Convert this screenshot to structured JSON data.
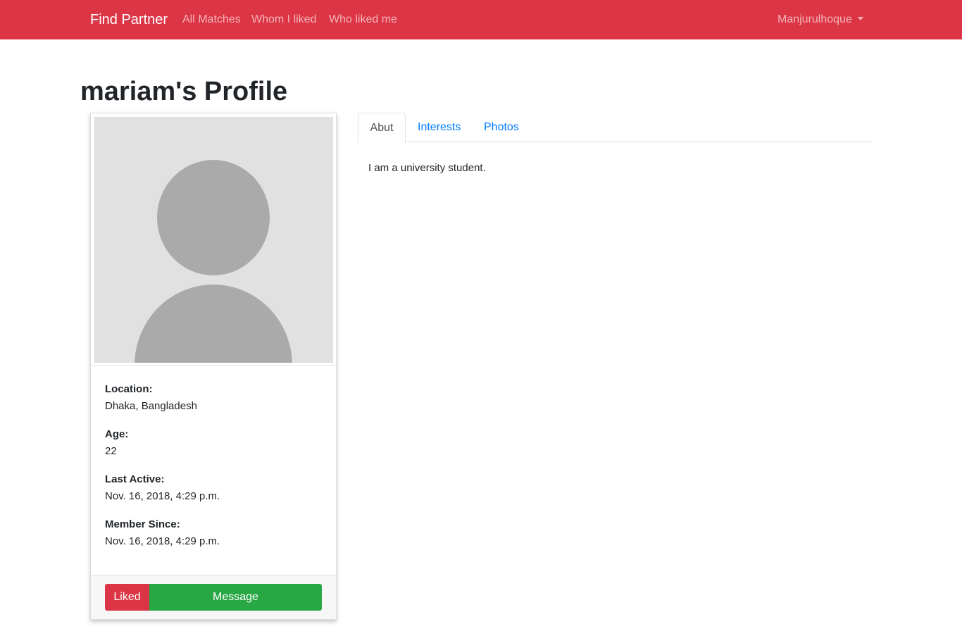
{
  "navbar": {
    "brand": "Find Partner",
    "links": [
      "All Matches",
      "Whom I liked",
      "Who liked me"
    ],
    "user": "Manjurulhoque",
    "color": "#dc3545"
  },
  "page": {
    "title": "mariam's Profile"
  },
  "profile": {
    "location_label": "Location:",
    "location": "Dhaka, Bangladesh",
    "age_label": "Age:",
    "age": "22",
    "last_active_label": "Last Active:",
    "last_active": "Nov. 16, 2018, 4:29 p.m.",
    "member_since_label": "Member Since:",
    "member_since": "Nov. 16, 2018, 4:29 p.m.",
    "liked_button": "Liked",
    "message_button": "Message"
  },
  "tabs": {
    "items": [
      "Abut",
      "Interests",
      "Photos"
    ],
    "active": "Abut"
  },
  "about": {
    "text": "I am a university student."
  },
  "colors": {
    "danger": "#dc3545",
    "success": "#28a745",
    "link": "#007bff"
  }
}
